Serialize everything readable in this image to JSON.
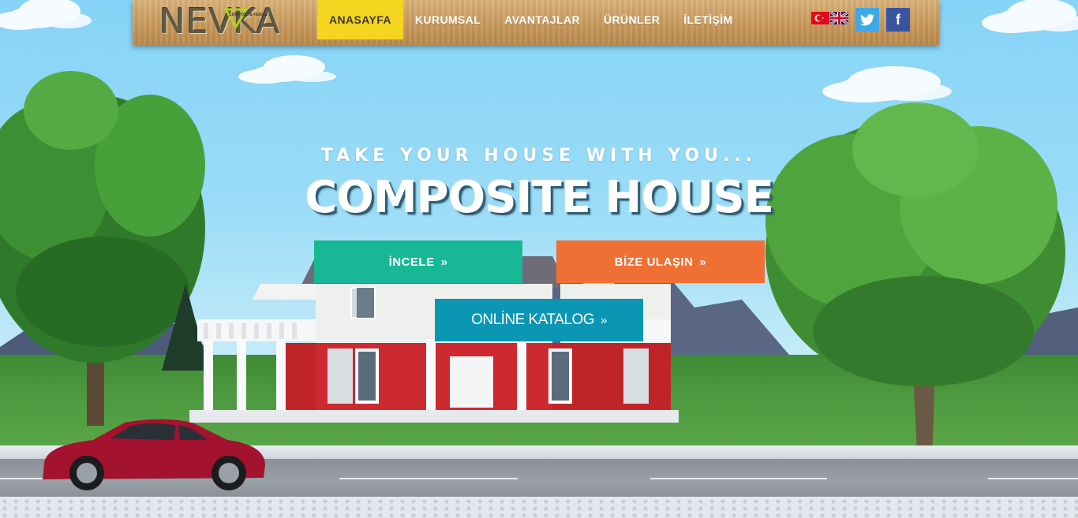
{
  "brand": {
    "logo_text": "NEVKA",
    "logo_subtext": "COMPOSITE HOUSE"
  },
  "nav": {
    "items": [
      {
        "label": "ANASAYFA",
        "active": true
      },
      {
        "label": "KURUMSAL",
        "active": false
      },
      {
        "label": "AVANTAJLAR",
        "active": false
      },
      {
        "label": "ÜRÜNLER",
        "active": false
      },
      {
        "label": "İLETİŞİM",
        "active": false
      }
    ]
  },
  "languages": [
    "tr-flag-icon",
    "en-flag-icon"
  ],
  "social": {
    "twitter": "twitter-icon",
    "facebook_label": "f"
  },
  "hero": {
    "tagline": "TAKE YOUR HOUSE WITH YOU...",
    "headline": "COMPOSITE HOUSE"
  },
  "buttons": {
    "incele": "İNCELE",
    "contact": "BİZE ULAŞIN",
    "catalog": "ONLİNE KATALOG",
    "chevron": "»"
  },
  "colors": {
    "active_nav": "#f4d520",
    "incele": "#18b796",
    "contact": "#f06f34",
    "catalog": "#0b96b4",
    "twitter": "#3fa9e8",
    "facebook": "#3a559f"
  }
}
